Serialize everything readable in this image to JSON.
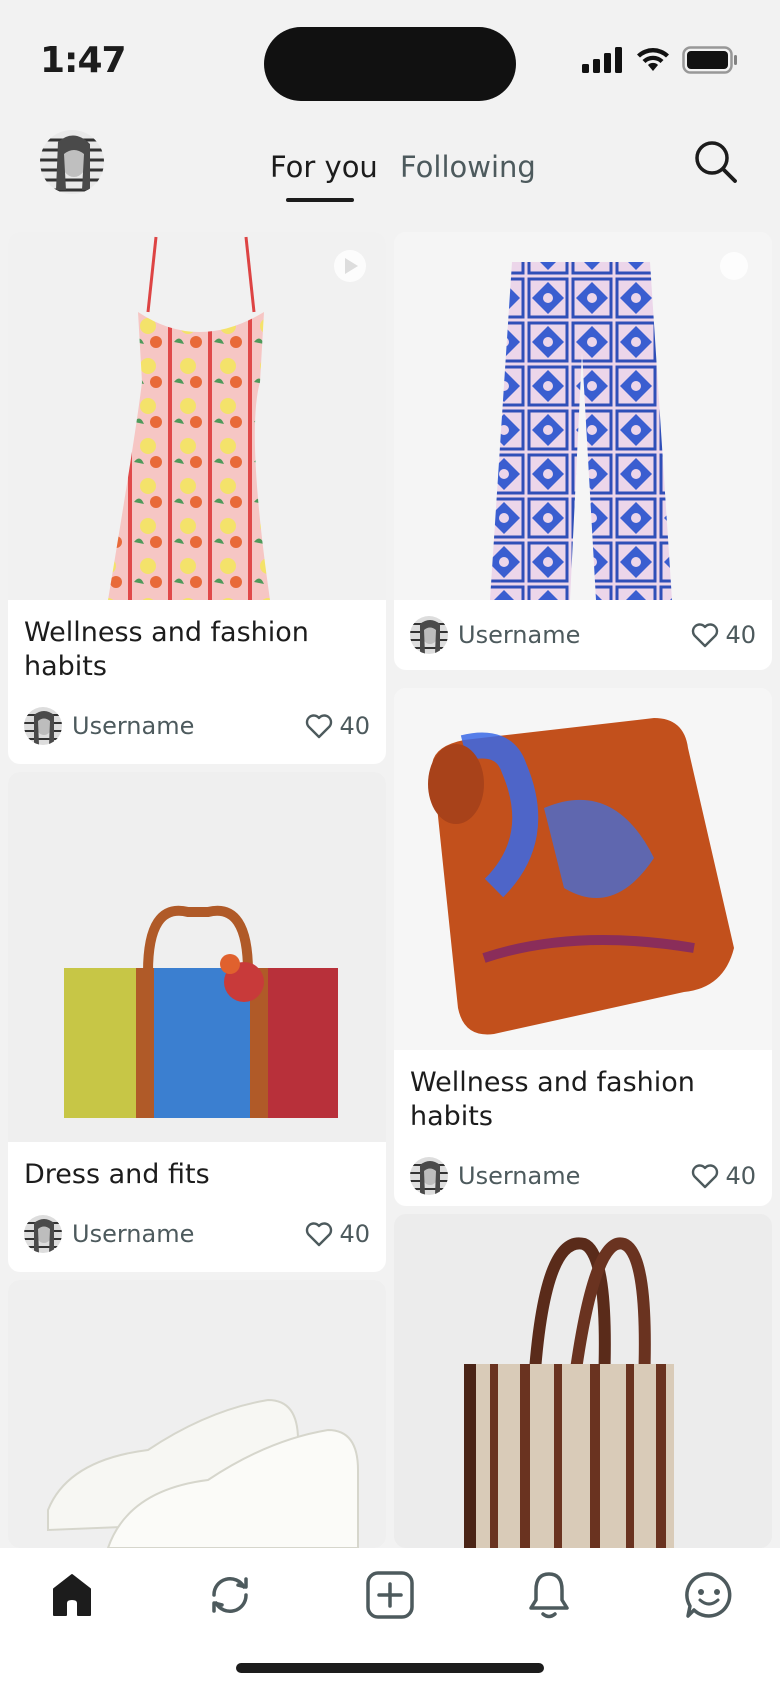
{
  "status_bar": {
    "time": "1:47"
  },
  "nav": {
    "tabs": [
      {
        "label": "For you",
        "active": true
      },
      {
        "label": "Following",
        "active": false
      }
    ]
  },
  "feed": {
    "cards": [
      {
        "title": "Wellness and fashion habits",
        "image": "floral-dress",
        "username": "Username",
        "likes": "40"
      },
      {
        "title": "",
        "image": "patterned-pants",
        "username": "Username",
        "likes": "40"
      },
      {
        "title": "",
        "image": "orange-blue-scarf",
        "username": "Username",
        "likes": "40",
        "title_text": "Wellness and fashion habits"
      },
      {
        "title": "Dress and fits",
        "image": "patchwork-tote-bag",
        "username": "Username",
        "likes": "40"
      },
      {
        "title": "",
        "image": "white-sneakers"
      },
      {
        "title": "",
        "image": "striped-handbag"
      }
    ]
  },
  "bottom_nav": {
    "items": [
      "home-icon",
      "refresh-icon",
      "add-icon",
      "bell-icon",
      "chat-icon"
    ]
  },
  "colors": {
    "accent_text": "#1c1c1c",
    "muted_text": "#4d5a5d",
    "background": "#f2f2f2"
  }
}
